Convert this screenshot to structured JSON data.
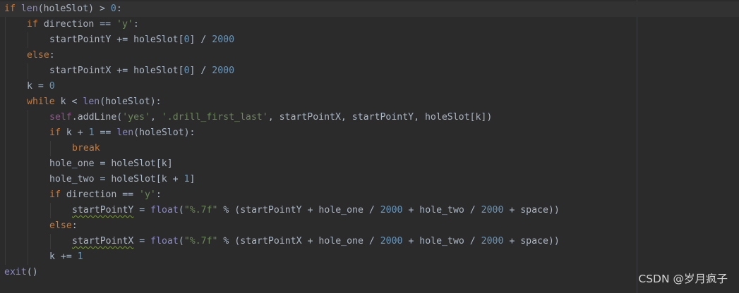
{
  "editor": {
    "code_lines": [
      {
        "indent": 0,
        "highlight": true,
        "tokens": [
          {
            "t": "if",
            "c": "kw"
          },
          {
            "t": " "
          },
          {
            "t": "len",
            "c": "bi"
          },
          {
            "t": "(holeSlot) > "
          },
          {
            "t": "0",
            "c": "num"
          },
          {
            "t": ":"
          }
        ]
      },
      {
        "indent": 1,
        "tokens": [
          {
            "t": "if",
            "c": "kw"
          },
          {
            "t": " direction == "
          },
          {
            "t": "'y'",
            "c": "str"
          },
          {
            "t": ":"
          }
        ]
      },
      {
        "indent": 2,
        "tokens": [
          {
            "t": "startPointY += holeSlot["
          },
          {
            "t": "0",
            "c": "num"
          },
          {
            "t": "] / "
          },
          {
            "t": "2000",
            "c": "num"
          }
        ]
      },
      {
        "indent": 1,
        "tokens": [
          {
            "t": "else",
            "c": "kw"
          },
          {
            "t": ":"
          }
        ]
      },
      {
        "indent": 2,
        "tokens": [
          {
            "t": "startPointX += holeSlot["
          },
          {
            "t": "0",
            "c": "num"
          },
          {
            "t": "] / "
          },
          {
            "t": "2000",
            "c": "num"
          }
        ]
      },
      {
        "indent": 1,
        "tokens": [
          {
            "t": "k = "
          },
          {
            "t": "0",
            "c": "num"
          }
        ]
      },
      {
        "indent": 1,
        "tokens": [
          {
            "t": "while",
            "c": "kw"
          },
          {
            "t": " k < "
          },
          {
            "t": "len",
            "c": "bi"
          },
          {
            "t": "(holeSlot):"
          }
        ]
      },
      {
        "indent": 2,
        "tokens": [
          {
            "t": "self",
            "c": "self"
          },
          {
            "t": ".addLine("
          },
          {
            "t": "'yes'",
            "c": "str"
          },
          {
            "t": ", "
          },
          {
            "t": "'.drill_first_last'",
            "c": "str"
          },
          {
            "t": ", startPointX, startPointY, holeSlot[k])"
          }
        ]
      },
      {
        "indent": 2,
        "tokens": [
          {
            "t": "if",
            "c": "kw"
          },
          {
            "t": " k + "
          },
          {
            "t": "1",
            "c": "num"
          },
          {
            "t": " == "
          },
          {
            "t": "len",
            "c": "bi"
          },
          {
            "t": "(holeSlot):"
          }
        ]
      },
      {
        "indent": 3,
        "tokens": [
          {
            "t": "break",
            "c": "kw"
          }
        ]
      },
      {
        "indent": 2,
        "tokens": [
          {
            "t": "hole_one = holeSlot[k]"
          }
        ]
      },
      {
        "indent": 2,
        "tokens": [
          {
            "t": "hole_two = holeSlot[k + "
          },
          {
            "t": "1",
            "c": "num"
          },
          {
            "t": "]"
          }
        ]
      },
      {
        "indent": 2,
        "tokens": [
          {
            "t": "if",
            "c": "kw"
          },
          {
            "t": " direction == "
          },
          {
            "t": "'y'",
            "c": "str"
          },
          {
            "t": ":"
          }
        ]
      },
      {
        "indent": 3,
        "tokens": [
          {
            "t": "startPointY",
            "c": "wavy"
          },
          {
            "t": " = "
          },
          {
            "t": "float",
            "c": "bi"
          },
          {
            "t": "("
          },
          {
            "t": "\"%.7f\"",
            "c": "str"
          },
          {
            "t": " % (startPointY + hole_one / "
          },
          {
            "t": "2000",
            "c": "num"
          },
          {
            "t": " + hole_two / "
          },
          {
            "t": "2000",
            "c": "num"
          },
          {
            "t": " + space))"
          }
        ]
      },
      {
        "indent": 2,
        "tokens": [
          {
            "t": "else",
            "c": "kw"
          },
          {
            "t": ":"
          }
        ]
      },
      {
        "indent": 3,
        "tokens": [
          {
            "t": "startPointX",
            "c": "wavy"
          },
          {
            "t": " = "
          },
          {
            "t": "float",
            "c": "bi"
          },
          {
            "t": "("
          },
          {
            "t": "\"%.7f\"",
            "c": "str"
          },
          {
            "t": " % (startPointX + hole_one / "
          },
          {
            "t": "2000",
            "c": "num"
          },
          {
            "t": " + hole_two / "
          },
          {
            "t": "2000",
            "c": "num"
          },
          {
            "t": " + space))"
          }
        ]
      },
      {
        "indent": 2,
        "tokens": [
          {
            "t": "k += "
          },
          {
            "t": "1",
            "c": "num"
          }
        ]
      },
      {
        "indent": 0,
        "tokens": [
          {
            "t": "exit",
            "c": "bi"
          },
          {
            "t": "()"
          }
        ]
      }
    ]
  },
  "watermark": {
    "text": "CSDN @岁月疯子"
  },
  "colors": {
    "background": "#2b2b2b",
    "keyword": "#cc7832",
    "builtin": "#8888c6",
    "number": "#6897bb",
    "string": "#6a8759",
    "self": "#94558d",
    "default_text": "#a9b7c6"
  }
}
